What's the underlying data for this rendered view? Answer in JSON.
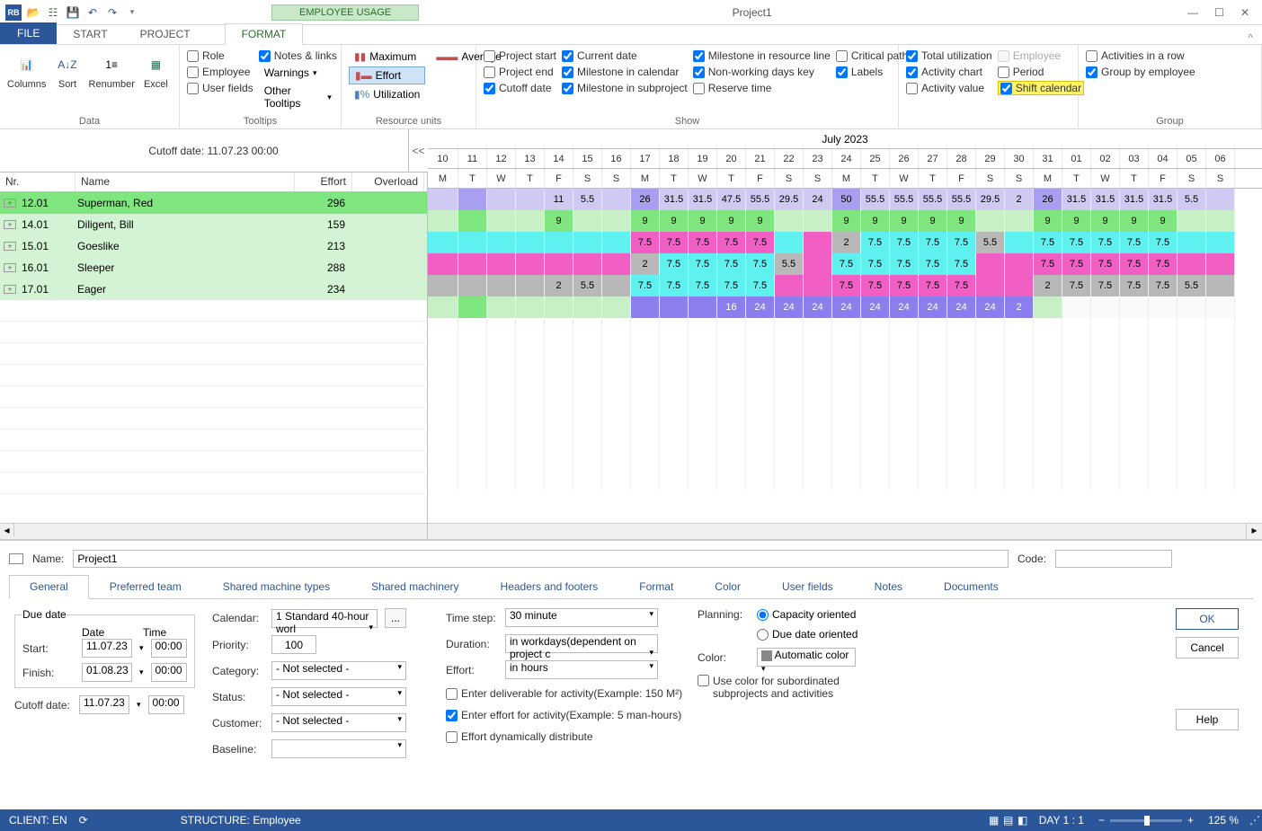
{
  "window": {
    "title": "Project1"
  },
  "qat_icons": [
    "app",
    "open",
    "tree",
    "save",
    "undo",
    "redo",
    "more"
  ],
  "context_tab": "EMPLOYEE USAGE",
  "tabs": {
    "file": "FILE",
    "start": "START",
    "project": "PROJECT",
    "format": "FORMAT"
  },
  "ribbon": {
    "data": {
      "label": "Data",
      "columns": "Columns",
      "sort": "Sort",
      "renumber": "Renumber",
      "excel": "Excel"
    },
    "tooltips": {
      "label": "Tooltips",
      "role": "Role",
      "employee": "Employee",
      "userfields": "User fields",
      "notes": "Notes & links",
      "warnings": "Warnings",
      "other": "Other Tooltips"
    },
    "ru": {
      "label": "Resource units",
      "max": "Maximum",
      "avg": "Average",
      "effort": "Effort",
      "util": "Utilization"
    },
    "show": {
      "label": "Show",
      "ps": "Project start",
      "pe": "Project end",
      "cd": "Cutoff date",
      "cur": "Current date",
      "mc": "Milestone in calendar",
      "ms": "Milestone in subproject",
      "mrl": "Milestone in resource line",
      "nwk": "Non-working days key",
      "rt": "Reserve time",
      "cp": "Critical path",
      "labels": "Labels"
    },
    "show2": {
      "tu": "Total utilization",
      "ac": "Activity chart",
      "av": "Activity value",
      "emp": "Employee",
      "per": "Period",
      "sc": "Shift calendar"
    },
    "group": {
      "label": "Group",
      "air": "Activities in a row",
      "gbe": "Group by employee"
    }
  },
  "left": {
    "cutoff": "Cutoff date: 11.07.23 00:00",
    "collapse": "<<",
    "cols": {
      "nr": "Nr.",
      "name": "Name",
      "effort": "Effort",
      "overload": "Overload"
    },
    "rows": [
      {
        "nr": "12.01",
        "name": "Superman, Red",
        "effort": "296"
      },
      {
        "nr": "14.01",
        "name": "Diligent, Bill",
        "effort": "159"
      },
      {
        "nr": "15.01",
        "name": "Goeslike",
        "effort": "213"
      },
      {
        "nr": "16.01",
        "name": "Sleeper",
        "effort": "288"
      },
      {
        "nr": "17.01",
        "name": "Eager",
        "effort": "234"
      }
    ]
  },
  "timeline": {
    "month": "July 2023",
    "days": [
      "10",
      "11",
      "12",
      "13",
      "14",
      "15",
      "16",
      "17",
      "18",
      "19",
      "20",
      "21",
      "22",
      "23",
      "24",
      "25",
      "26",
      "27",
      "28",
      "29",
      "30",
      "31",
      "01",
      "02",
      "03",
      "04",
      "05",
      "06"
    ],
    "dow": [
      "M",
      "T",
      "W",
      "T",
      "F",
      "S",
      "S",
      "M",
      "T",
      "W",
      "T",
      "F",
      "S",
      "S",
      "M",
      "T",
      "W",
      "T",
      "F",
      "S",
      "S",
      "M",
      "T",
      "W",
      "T",
      "F",
      "S",
      "S"
    ],
    "totals": [
      "",
      "",
      "",
      "",
      "11",
      "5.5",
      "",
      "26",
      "31.5",
      "31.5",
      "47.5",
      "55.5",
      "29.5",
      "24",
      "50",
      "55.5",
      "55.5",
      "55.5",
      "55.5",
      "29.5",
      "2",
      "26",
      "31.5",
      "31.5",
      "31.5",
      "31.5",
      "5.5",
      ""
    ],
    "totcls": [
      "c-lpur",
      "c-dpur",
      "c-lpur",
      "c-lpur",
      "c-lpur",
      "c-lpur",
      "c-lpur",
      "c-dpur",
      "c-lpur",
      "c-lpur",
      "c-lpur",
      "c-lpur",
      "c-lpur",
      "c-lpur",
      "c-dpur",
      "c-lpur",
      "c-lpur",
      "c-lpur",
      "c-lpur",
      "c-lpur",
      "c-lpur",
      "c-dpur",
      "c-lpur",
      "c-lpur",
      "c-lpur",
      "c-lpur",
      "c-lpur",
      "c-lpur"
    ],
    "rows": [
      {
        "cells": [
          "",
          "",
          "",
          "",
          "9",
          "",
          "",
          "9",
          "9",
          "9",
          "9",
          "9",
          "",
          "",
          "9",
          "9",
          "9",
          "9",
          "9",
          "",
          "",
          "9",
          "9",
          "9",
          "9",
          "9",
          "",
          ""
        ],
        "cls": [
          "c-lgrn",
          "c-grn",
          "c-lgrn",
          "c-lgrn",
          "c-grn",
          "c-lgrn",
          "c-lgrn",
          "c-grn",
          "c-grn",
          "c-grn",
          "c-grn",
          "c-grn",
          "c-lgrn",
          "c-lgrn",
          "c-grn",
          "c-grn",
          "c-grn",
          "c-grn",
          "c-grn",
          "c-lgrn",
          "c-lgrn",
          "c-grn",
          "c-grn",
          "c-grn",
          "c-grn",
          "c-grn",
          "c-lgrn",
          "c-lgrn"
        ]
      },
      {
        "cells": [
          "",
          "",
          "",
          "",
          "",
          "",
          "",
          "7.5",
          "7.5",
          "7.5",
          "7.5",
          "7.5",
          "",
          "",
          "2",
          "7.5",
          "7.5",
          "7.5",
          "7.5",
          "5.5",
          "",
          "7.5",
          "7.5",
          "7.5",
          "7.5",
          "7.5",
          "",
          ""
        ],
        "cls": [
          "c-cyan",
          "c-cyan",
          "c-cyan",
          "c-cyan",
          "c-cyan",
          "c-cyan",
          "c-cyan",
          "c-mag",
          "c-mag",
          "c-mag",
          "c-mag",
          "c-mag",
          "c-cyan",
          "c-mag",
          "c-gray",
          "c-cyan",
          "c-cyan",
          "c-cyan",
          "c-cyan",
          "c-gray",
          "c-cyan",
          "c-cyan",
          "c-cyan",
          "c-cyan",
          "c-cyan",
          "c-cyan",
          "c-cyan",
          "c-cyan"
        ]
      },
      {
        "cells": [
          "",
          "",
          "",
          "",
          "",
          "",
          "",
          "2",
          "7.5",
          "7.5",
          "7.5",
          "7.5",
          "5.5",
          "",
          "7.5",
          "7.5",
          "7.5",
          "7.5",
          "7.5",
          "",
          "",
          "7.5",
          "7.5",
          "7.5",
          "7.5",
          "7.5",
          "",
          ""
        ],
        "cls": [
          "c-mag",
          "c-mag",
          "c-mag",
          "c-mag",
          "c-mag",
          "c-mag",
          "c-mag",
          "c-gray",
          "c-cyan",
          "c-cyan",
          "c-cyan",
          "c-cyan",
          "c-gray",
          "c-mag",
          "c-cyan",
          "c-cyan",
          "c-cyan",
          "c-cyan",
          "c-cyan",
          "c-mag",
          "c-mag",
          "c-mag",
          "c-mag",
          "c-mag",
          "c-mag",
          "c-mag",
          "c-mag",
          "c-mag"
        ]
      },
      {
        "cells": [
          "",
          "",
          "",
          "",
          "2",
          "5.5",
          "",
          "7.5",
          "7.5",
          "7.5",
          "7.5",
          "7.5",
          "",
          "",
          "7.5",
          "7.5",
          "7.5",
          "7.5",
          "7.5",
          "",
          "",
          "2",
          "7.5",
          "7.5",
          "7.5",
          "7.5",
          "5.5",
          ""
        ],
        "cls": [
          "c-gray",
          "c-gray",
          "c-gray",
          "c-gray",
          "c-gray",
          "c-gray",
          "c-gray",
          "c-cyan",
          "c-cyan",
          "c-cyan",
          "c-cyan",
          "c-cyan",
          "c-mag",
          "c-mag",
          "c-mag",
          "c-mag",
          "c-mag",
          "c-mag",
          "c-mag",
          "c-mag",
          "c-mag",
          "c-gray",
          "c-gray",
          "c-gray",
          "c-gray",
          "c-gray",
          "c-gray",
          "c-gray"
        ]
      },
      {
        "cells": [
          "",
          "",
          "",
          "",
          "",
          "",
          "",
          "",
          "",
          "",
          "16",
          "24",
          "24",
          "24",
          "24",
          "24",
          "24",
          "24",
          "24",
          "24",
          "2",
          "",
          "",
          "",
          "",
          "",
          "",
          ""
        ],
        "cls": [
          "c-lgrn",
          "c-grn",
          "c-lgrn",
          "c-lgrn",
          "c-lgrn",
          "c-lgrn",
          "c-lgrn",
          "c-violet",
          "c-violet",
          "c-violet",
          "c-violet",
          "c-violet",
          "c-violet",
          "c-violet",
          "c-violet",
          "c-violet",
          "c-violet",
          "c-violet",
          "c-violet",
          "c-violet",
          "c-violet",
          "c-lgrn",
          "c-wh2",
          "c-wh2",
          "c-wh2",
          "c-wh2",
          "c-wh2",
          "c-wh2"
        ]
      }
    ]
  },
  "bottom": {
    "name_lbl": "Name:",
    "name_val": "Project1",
    "code_lbl": "Code:",
    "tabs": [
      "General",
      "Preferred team",
      "Shared machine types",
      "Shared machinery",
      "Headers and footers",
      "Format",
      "Color",
      "User fields",
      "Notes",
      "Documents"
    ],
    "duedate": "Due date",
    "date": "Date",
    "time": "Time",
    "start": "Start:",
    "start_d": "11.07.23",
    "start_t": "00:00",
    "finish": "Finish:",
    "finish_d": "01.08.23",
    "finish_t": "00:00",
    "cutoff": "Cutoff date:",
    "cutoff_d": "11.07.23",
    "cutoff_t": "00:00",
    "calendar": "Calendar:",
    "calendar_v": "1 Standard 40-hour worl",
    "priority": "Priority:",
    "priority_v": "100",
    "category": "Category:",
    "status": "Status:",
    "customer": "Customer:",
    "baseline": "Baseline:",
    "notsel": "- Not selected -",
    "timestep": "Time step:",
    "timestep_v": "30 minute",
    "duration": "Duration:",
    "duration_v": "in workdays(dependent on project c",
    "effort": "Effort:",
    "effort_v": "in hours",
    "edel": "Enter deliverable for activity(Example: 150 M²)",
    "eeff": "Enter effort for activity(Example: 5 man-hours)",
    "edyn": "Effort dynamically distribute",
    "planning": "Planning:",
    "cap": "Capacity oriented",
    "ddo": "Due date oriented",
    "color": "Color:",
    "color_v": "Automatic color",
    "usecolor": "Use color for subordinated subprojects and activities",
    "ok": "OK",
    "cancel": "Cancel",
    "help": "Help",
    "ellipsis": "..."
  },
  "status": {
    "client": "CLIENT: EN",
    "struct": "STRUCTURE: Employee",
    "day": "DAY 1 : 1",
    "zoom": "125 %"
  }
}
